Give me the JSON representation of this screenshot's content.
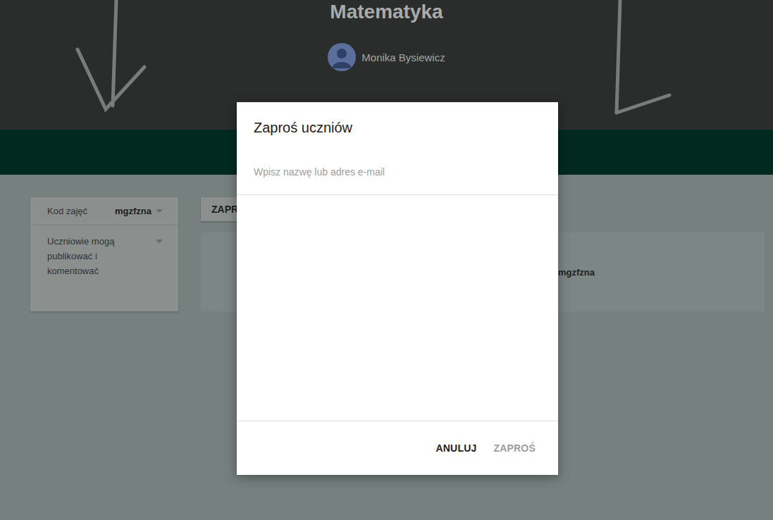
{
  "course": {
    "title": "Matematyka",
    "teacher": "Monika Bysiewicz"
  },
  "sidebar": {
    "class_code_label": "Kod zajęć",
    "class_code": "mgzfzna",
    "stream_setting": "Uczniowie mogą publikować i komentować"
  },
  "stream": {
    "invite_button": "ZAPR",
    "code_text": "mgzfzna"
  },
  "dialog": {
    "title": "Zaproś uczniów",
    "search": {
      "placeholder": "Wpisz nazwę lub adres e-mail"
    },
    "buttons": [
      {
        "label": "ANULUJ",
        "disabled": false
      },
      {
        "label": "ZAPROŚ",
        "disabled": true
      }
    ]
  }
}
